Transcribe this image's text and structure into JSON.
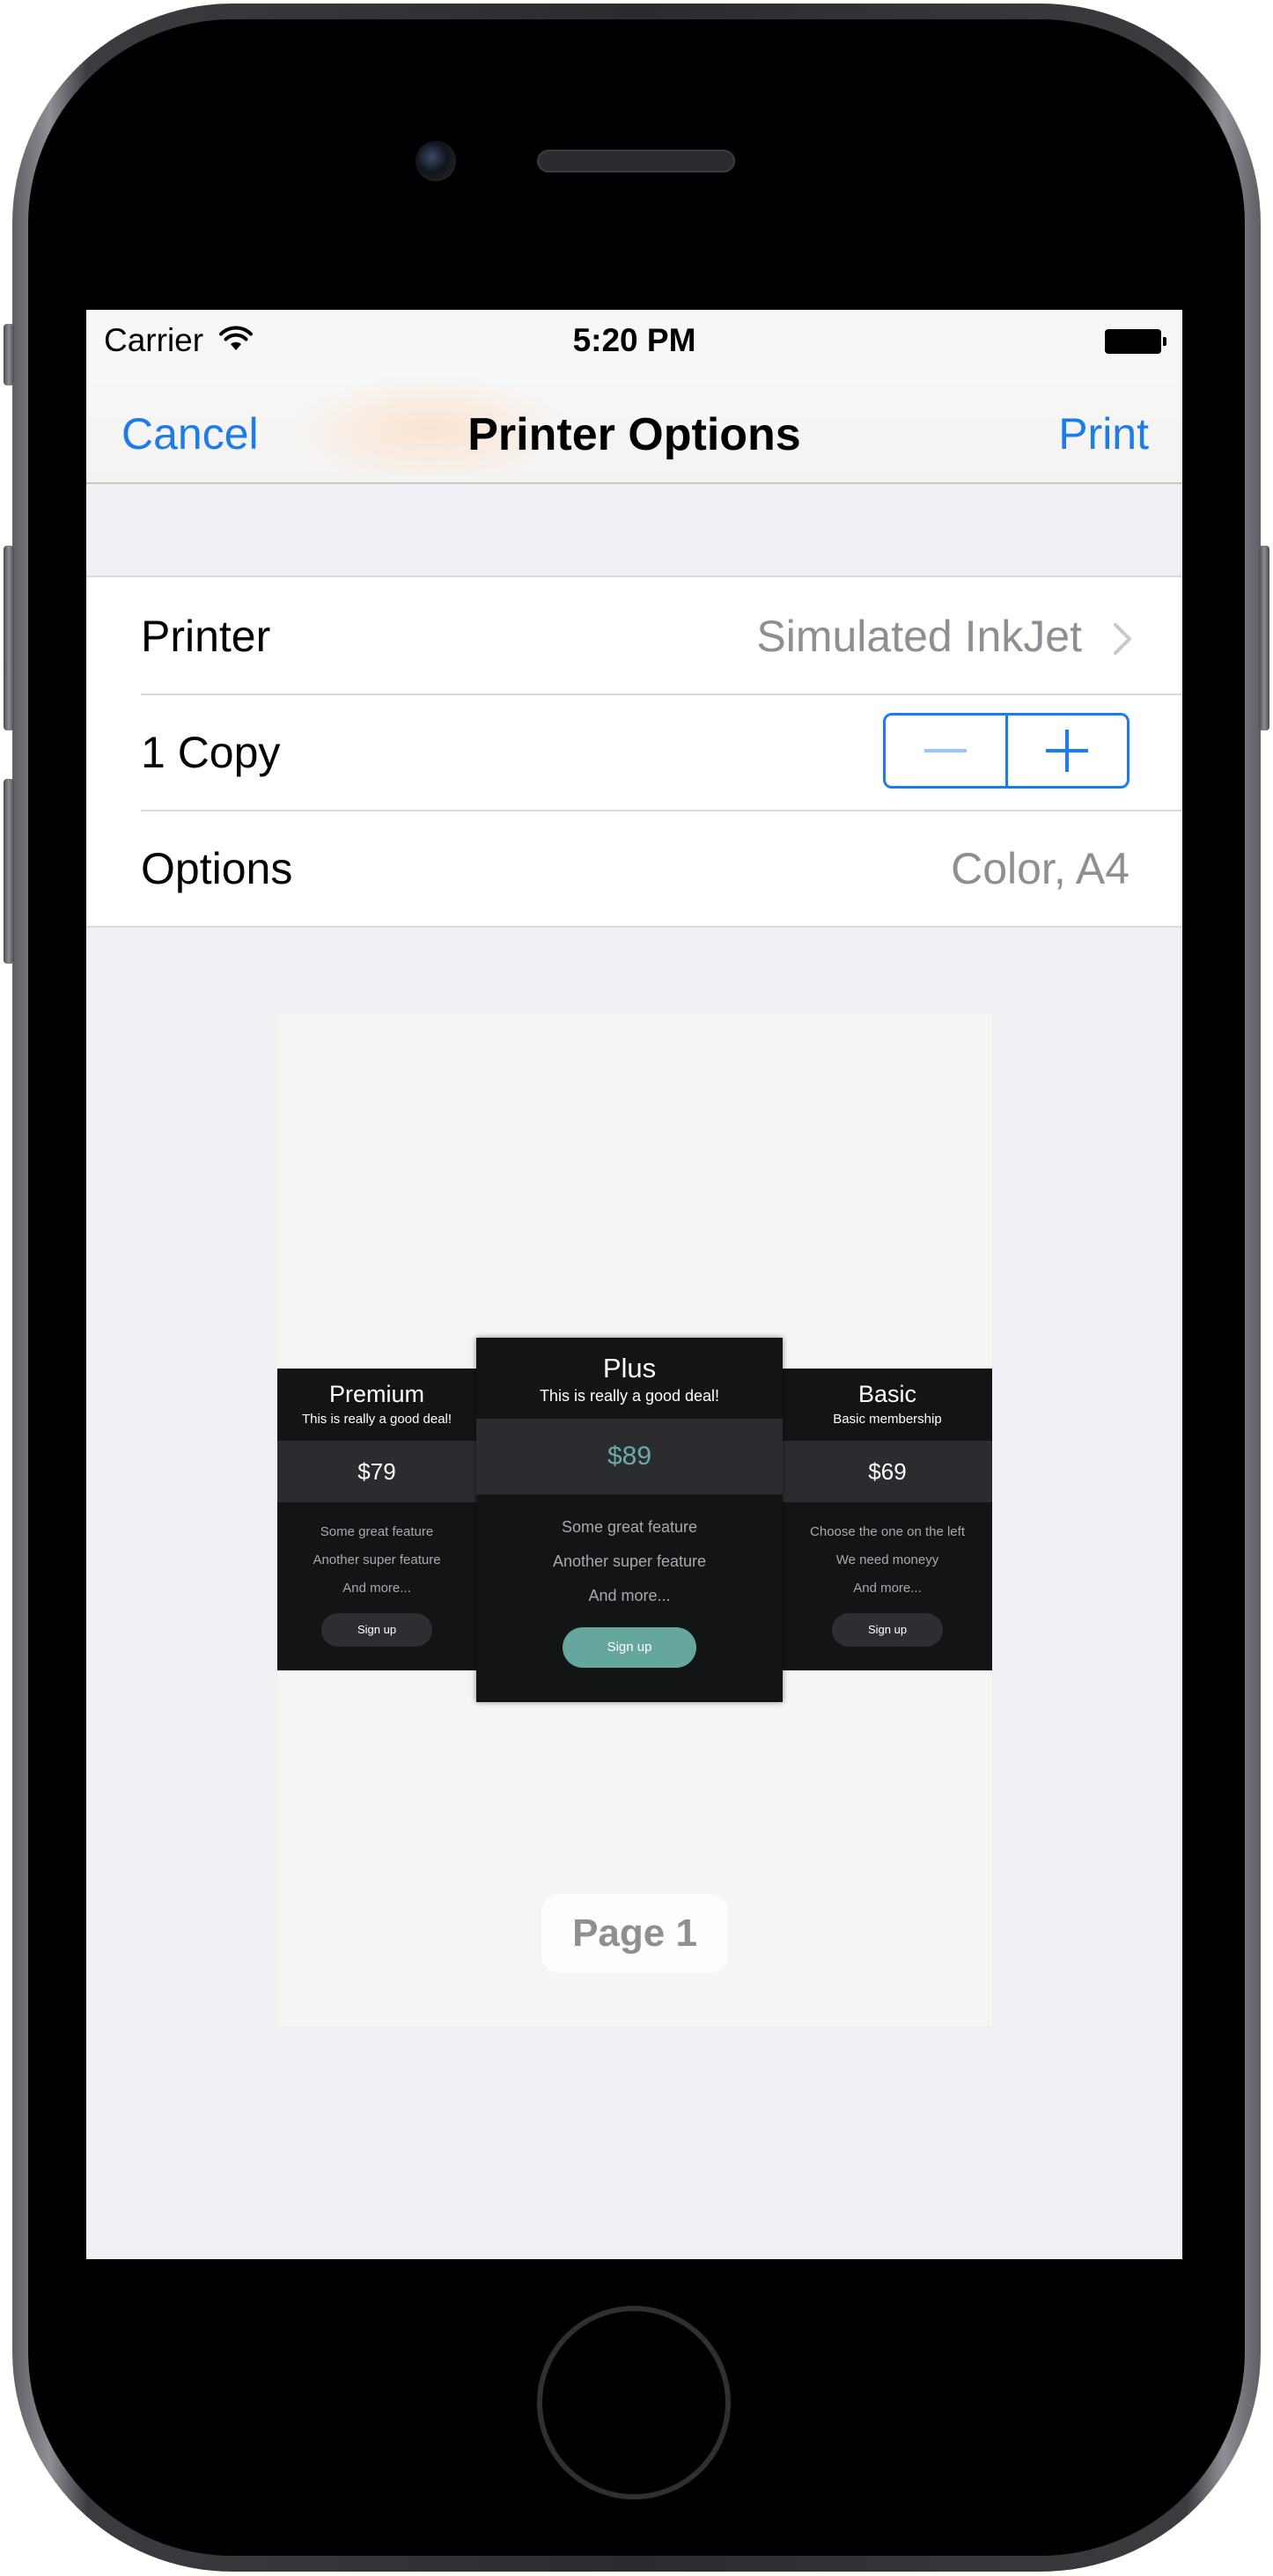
{
  "status_bar": {
    "carrier": "Carrier",
    "time": "5:20 PM"
  },
  "nav": {
    "cancel_label": "Cancel",
    "title": "Printer Options",
    "print_label": "Print"
  },
  "options": {
    "printer_label": "Printer",
    "printer_value": "Simulated InkJet",
    "copies_label": "1 Copy",
    "options_label": "Options",
    "options_value": "Color, A4"
  },
  "preview": {
    "page_label": "Page 1",
    "plans": {
      "premium": {
        "name": "Premium",
        "subtitle": "This is really a good deal!",
        "price": "$79",
        "features": [
          "Some great feature",
          "Another super feature",
          "And more..."
        ],
        "signup": "Sign up"
      },
      "plus": {
        "name": "Plus",
        "subtitle": "This is really a good deal!",
        "price": "$89",
        "features": [
          "Some great feature",
          "Another super feature",
          "And more..."
        ],
        "signup": "Sign up"
      },
      "basic": {
        "name": "Basic",
        "subtitle": "Basic membership",
        "price": "$69",
        "features": [
          "Choose the one on the left",
          "We need moneyy",
          "And more..."
        ],
        "signup": "Sign up"
      }
    }
  },
  "colors": {
    "tint": "#1a7cf2",
    "secondary_text": "#8e8e93",
    "plus_accent": "#65a69d"
  },
  "icons": {
    "wifi": "wifi-icon",
    "battery": "battery-icon",
    "chevron": "chevron-right-icon",
    "minus": "minus-icon",
    "plus": "plus-icon"
  }
}
